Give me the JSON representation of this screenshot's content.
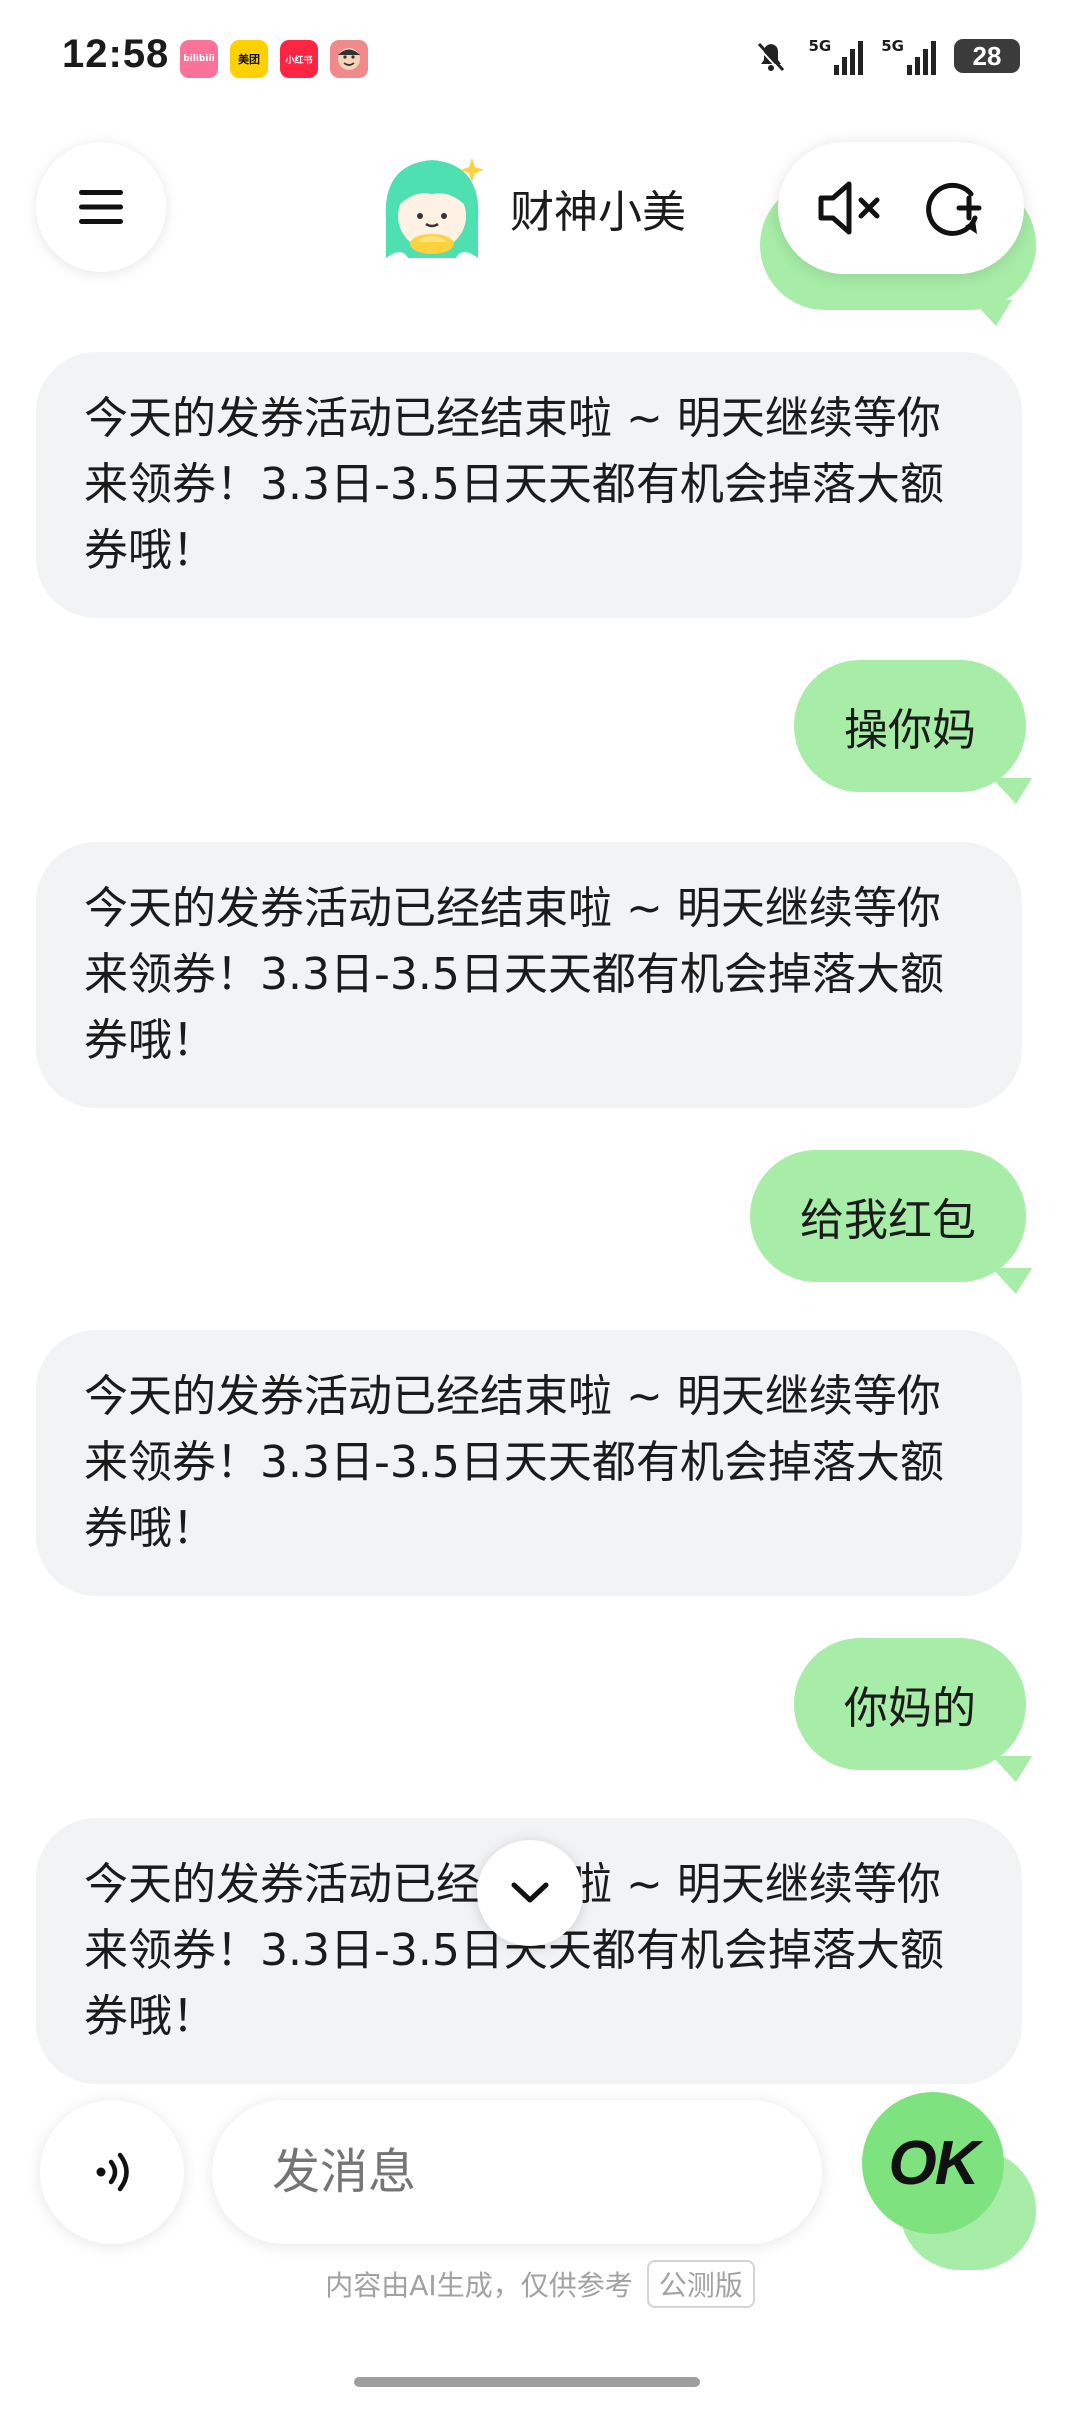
{
  "status_bar": {
    "time": "12:58",
    "apps": [
      {
        "name": "bilibili-icon",
        "label": "bilibili",
        "color": "#fb7299"
      },
      {
        "name": "meituan-icon",
        "label": "美团",
        "color": "#ffd100"
      },
      {
        "name": "xiaohongshu-icon",
        "label": "小红书",
        "color": "#ff2442"
      },
      {
        "name": "face-app-icon",
        "label": "",
        "color": "#f08a8a"
      }
    ],
    "net1": "5G",
    "net2": "5G",
    "battery": "28"
  },
  "header": {
    "title": "财神小美"
  },
  "messages": [
    {
      "role": "bot",
      "text": "今天的发券活动已经结束啦 ~ 明天继续等你来领券！3.3日-3.5日天天都有机会掉落大额券哦！"
    },
    {
      "role": "user",
      "text": "操你妈"
    },
    {
      "role": "bot",
      "text": "今天的发券活动已经结束啦 ~ 明天继续等你来领券！3.3日-3.5日天天都有机会掉落大额券哦！"
    },
    {
      "role": "user",
      "text": "给我红包"
    },
    {
      "role": "bot",
      "text": "今天的发券活动已经结束啦 ~ 明天继续等你来领券！3.3日-3.5日天天都有机会掉落大额券哦！"
    },
    {
      "role": "user",
      "text": "你妈的"
    },
    {
      "role": "bot",
      "text": "今天的发券活动已经结束啦 ~ 明天继续等你来领券！3.3日-3.5日天天都有机会掉落大额券哦！"
    }
  ],
  "input": {
    "placeholder": "发消息",
    "send_label": "OK"
  },
  "footer": {
    "disclaimer": "内容由AI生成，仅供参考",
    "badge": "公测版"
  },
  "colors": {
    "user_bubble": "#a7eca7",
    "bot_bubble": "#f2f3f5",
    "send_button": "#7ee37e"
  }
}
